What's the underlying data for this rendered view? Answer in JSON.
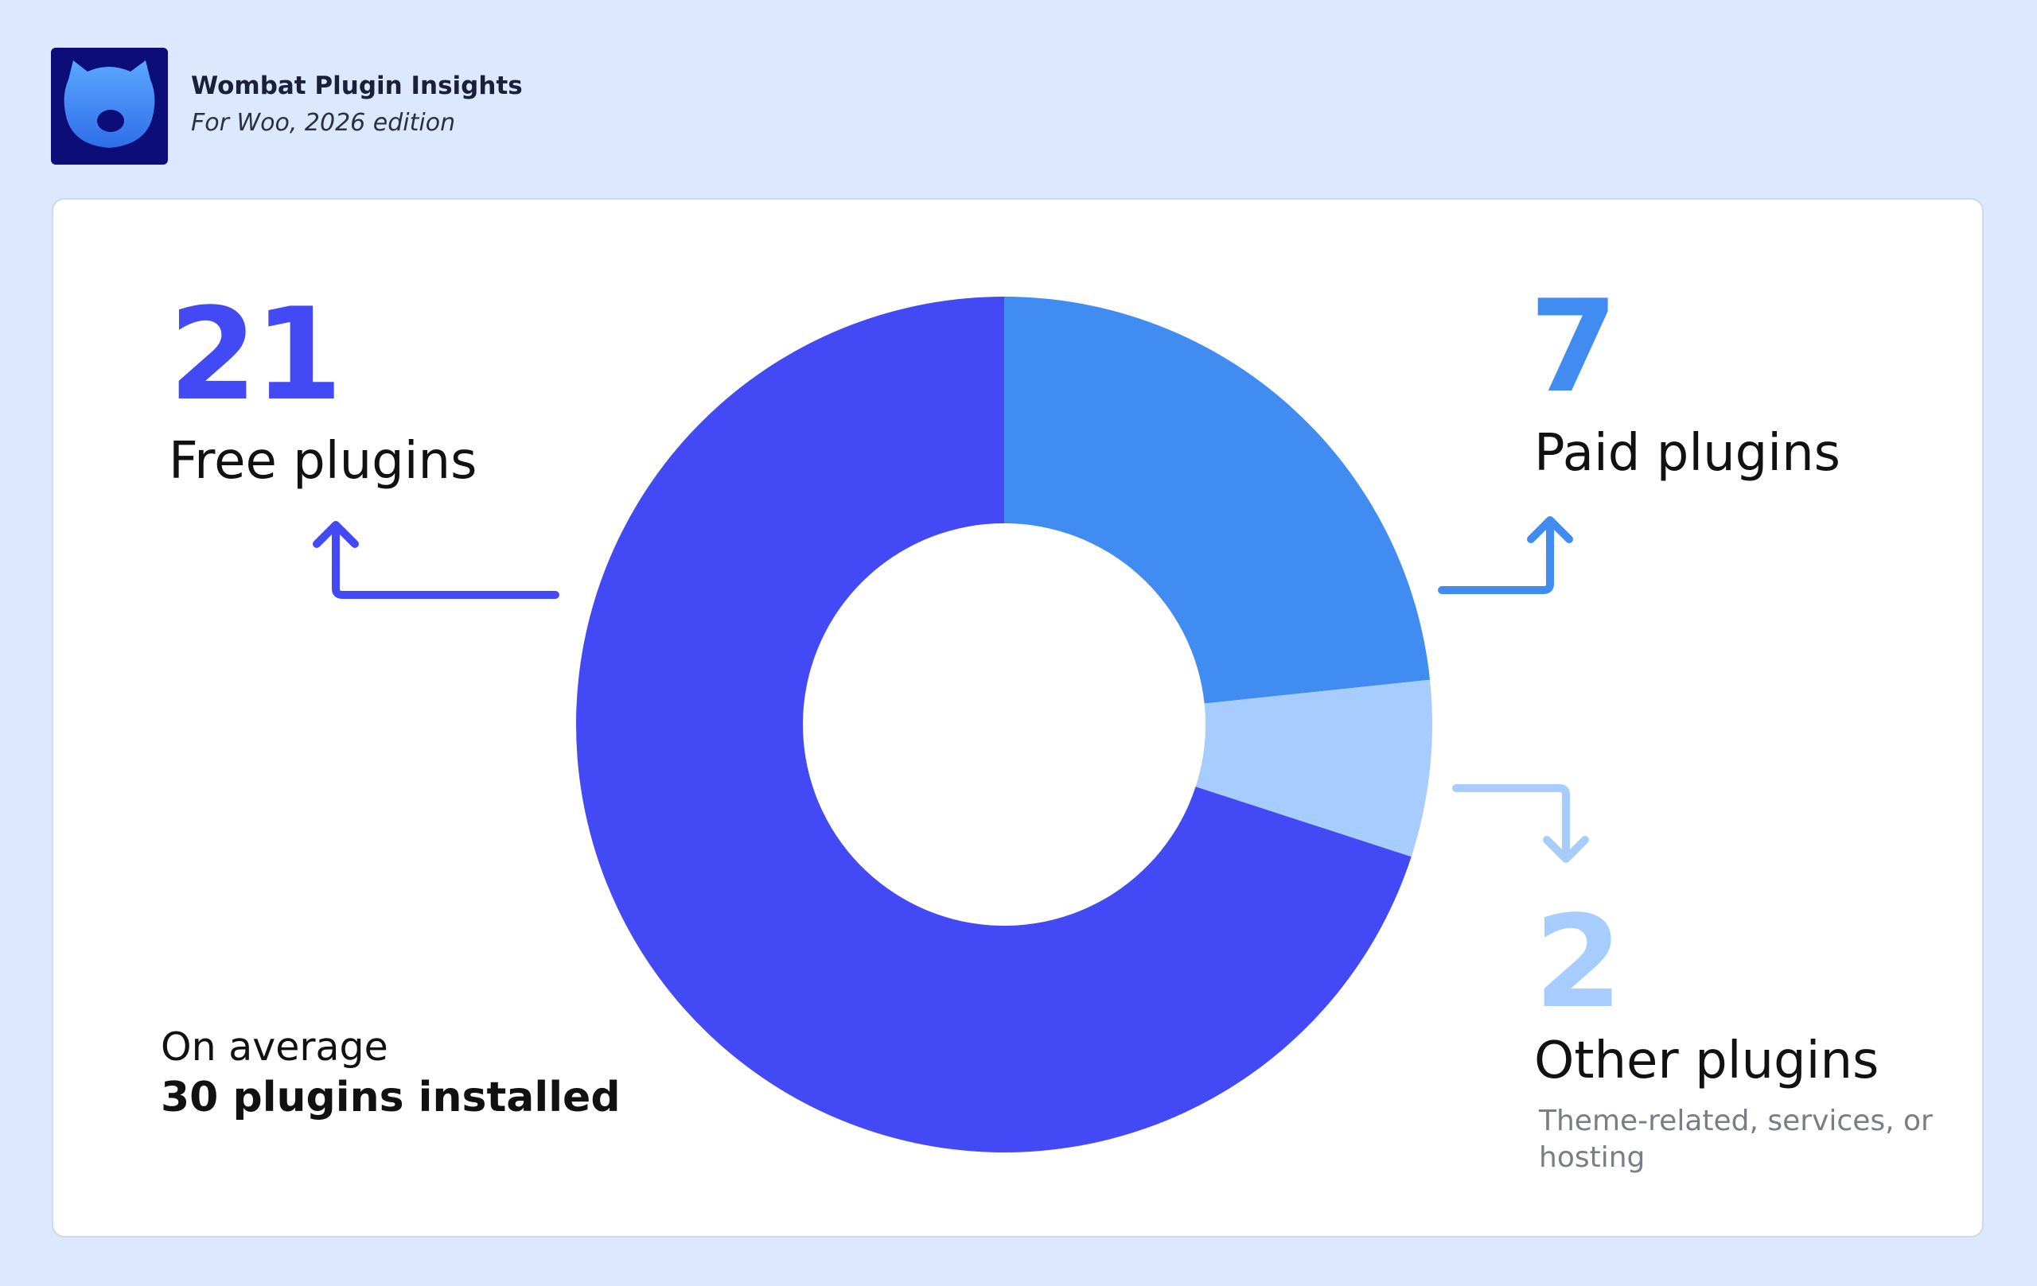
{
  "header": {
    "logo_icon": "wombat-head-icon",
    "title": "Wombat Plugin Insights",
    "subtitle": "For Woo, 2026 edition"
  },
  "summary": {
    "line1": "On average",
    "line2": "30 plugins installed"
  },
  "colors": {
    "free": "#4349f4",
    "paid": "#418cf1",
    "other": "#a6cdfd",
    "background": "#dce8fd",
    "card": "#ffffff"
  },
  "chart_data": {
    "type": "pie",
    "total": 30,
    "slices": [
      {
        "name": "Paid plugins",
        "value": 7,
        "color": "#418cf1"
      },
      {
        "name": "Other plugins",
        "value": 2,
        "color": "#a6cdfd",
        "note": "Theme-related, services, or hosting"
      },
      {
        "name": "Free plugins",
        "value": 21,
        "color": "#4349f4"
      }
    ]
  },
  "callouts": {
    "free": {
      "number": "21",
      "label": "Free plugins"
    },
    "paid": {
      "number": "7",
      "label": "Paid plugins"
    },
    "other": {
      "number": "2",
      "label": "Other plugins",
      "note": "Theme-related, services, or hosting"
    }
  }
}
